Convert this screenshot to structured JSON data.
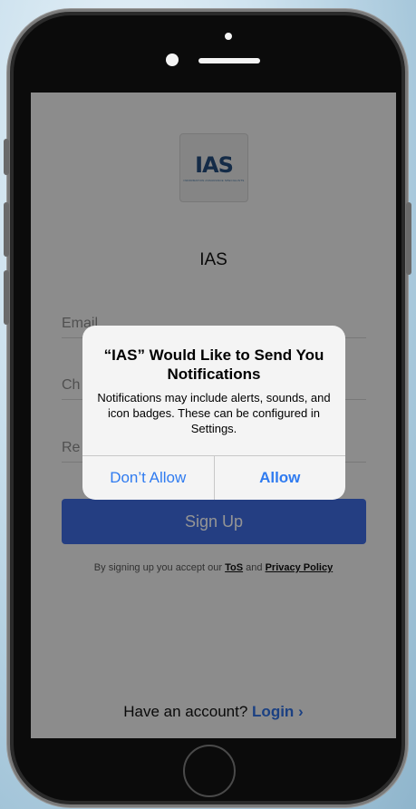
{
  "app": {
    "logo_text": "IAS",
    "logo_subtext": "INFORMATION ASSURANCE SPECIALISTS",
    "title": "IAS"
  },
  "form": {
    "email_placeholder": "Email",
    "choose_password_placeholder": "Ch",
    "repeat_password_placeholder": "Re",
    "signup_label": "Sign Up"
  },
  "terms": {
    "prefix": "By signing up you accept our",
    "tos_label": "ToS",
    "and": "and",
    "privacy_label": "Privacy Policy"
  },
  "footer": {
    "have_account": "Have an account?",
    "login_label": "Login",
    "login_chevron": "›"
  },
  "alert": {
    "title": "“IAS” Would Like to Send You Notifications",
    "message": "Notifications may include alerts, sounds, and icon badges. These can be configured in Settings.",
    "dont_allow_label": "Don’t Allow",
    "allow_label": "Allow"
  },
  "colors": {
    "primary": "#3f6be0",
    "link": "#2f7bf0"
  }
}
